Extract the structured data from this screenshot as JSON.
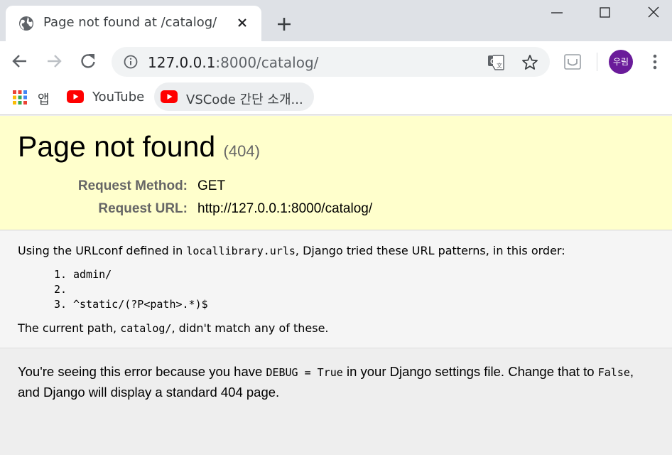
{
  "browser": {
    "tab": {
      "title": "Page not found at /catalog/"
    },
    "address": {
      "host": "127.0.0.1",
      "rest": ":8000/catalog/"
    },
    "profile_initials": "우림",
    "bookmarks": [
      {
        "label": "앱",
        "icon": "apps-grid-icon"
      },
      {
        "label": "YouTube",
        "icon": "youtube-icon"
      },
      {
        "label": "VSCode 간단 소개...",
        "icon": "youtube-icon"
      }
    ]
  },
  "page": {
    "title": "Page not found",
    "status_code": "(404)",
    "request": [
      {
        "label": "Request Method:",
        "value": "GET"
      },
      {
        "label": "Request URL:",
        "value": "http://127.0.0.1:8000/catalog/"
      }
    ],
    "intro_prefix": "Using the URLconf defined in ",
    "urlconf": "locallibrary.urls",
    "intro_suffix": ", Django tried these URL patterns, in this order:",
    "patterns": [
      {
        "num": "1.",
        "text": "admin/"
      },
      {
        "num": "2.",
        "text": ""
      },
      {
        "num": "3.",
        "text": "^static/(?P<path>.*)$"
      }
    ],
    "current_prefix": "The current path, ",
    "current_path": "catalog/",
    "current_suffix": ", didn't match any of these.",
    "explain_1": "You're seeing this error because you have ",
    "explain_code": "DEBUG = True",
    "explain_2": " in your Django settings file. Change that to ",
    "explain_code2": "False",
    "explain_3": ", and Django will display a standard 404 page."
  },
  "colors": {
    "summary_bg": "#ffffcc",
    "avatar": "#6a1b9a",
    "youtube_red": "#ff0000"
  }
}
